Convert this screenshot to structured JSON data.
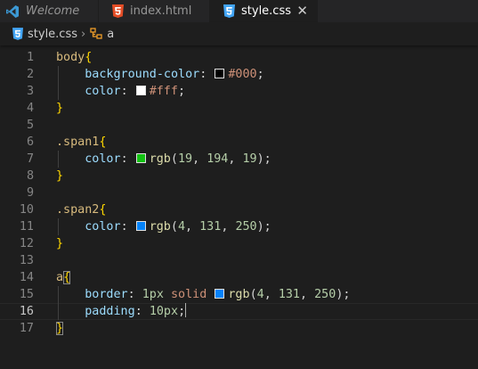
{
  "tabs": [
    {
      "label": "Welcome",
      "icon": "vscode-icon",
      "active": false,
      "italic": true
    },
    {
      "label": "index.html",
      "icon": "html5-icon",
      "active": false
    },
    {
      "label": "style.css",
      "icon": "css3-icon",
      "active": true,
      "close": "✕"
    }
  ],
  "breadcrumb": {
    "file": "style.css",
    "separator": "›",
    "symbol": "a"
  },
  "colors": {
    "tab_bar": "#252526",
    "editor_bg": "#1e1e1e",
    "html_icon": "#e44d26",
    "css_icon": "#42a5f5",
    "vscode_icon": "#3c99d4"
  },
  "editor": {
    "current_line": 16,
    "lines": [
      {
        "n": "1",
        "tokens": [
          [
            "sel",
            "body"
          ],
          [
            "brace",
            "{"
          ]
        ]
      },
      {
        "n": "2",
        "tokens": [
          [
            "ws",
            "    "
          ],
          [
            "prop",
            "background-color"
          ],
          [
            "punc",
            ": "
          ],
          [
            "swatch",
            "#000000"
          ],
          [
            "val",
            "#000"
          ],
          [
            "punc",
            ";"
          ]
        ]
      },
      {
        "n": "3",
        "tokens": [
          [
            "ws",
            "    "
          ],
          [
            "prop",
            "color"
          ],
          [
            "punc",
            ": "
          ],
          [
            "swatch",
            "#ffffff"
          ],
          [
            "val",
            "#fff"
          ],
          [
            "punc",
            ";"
          ]
        ]
      },
      {
        "n": "4",
        "tokens": [
          [
            "brace",
            "}"
          ]
        ]
      },
      {
        "n": "5",
        "tokens": []
      },
      {
        "n": "6",
        "tokens": [
          [
            "sel",
            ".span1"
          ],
          [
            "brace",
            "{"
          ]
        ]
      },
      {
        "n": "7",
        "tokens": [
          [
            "ws",
            "    "
          ],
          [
            "prop",
            "color"
          ],
          [
            "punc",
            ": "
          ],
          [
            "swatch",
            "#13c213"
          ],
          [
            "fn",
            "rgb"
          ],
          [
            "punc",
            "("
          ],
          [
            "num",
            "19"
          ],
          [
            "punc",
            ", "
          ],
          [
            "num",
            "194"
          ],
          [
            "punc",
            ", "
          ],
          [
            "num",
            "19"
          ],
          [
            "punc",
            ");"
          ]
        ]
      },
      {
        "n": "8",
        "tokens": [
          [
            "brace",
            "}"
          ]
        ]
      },
      {
        "n": "9",
        "tokens": []
      },
      {
        "n": "10",
        "tokens": [
          [
            "sel",
            ".span2"
          ],
          [
            "brace",
            "{"
          ]
        ]
      },
      {
        "n": "11",
        "tokens": [
          [
            "ws",
            "    "
          ],
          [
            "prop",
            "color"
          ],
          [
            "punc",
            ": "
          ],
          [
            "swatch",
            "#0483fa"
          ],
          [
            "fn",
            "rgb"
          ],
          [
            "punc",
            "("
          ],
          [
            "num",
            "4"
          ],
          [
            "punc",
            ", "
          ],
          [
            "num",
            "131"
          ],
          [
            "punc",
            ", "
          ],
          [
            "num",
            "250"
          ],
          [
            "punc",
            ");"
          ]
        ]
      },
      {
        "n": "12",
        "tokens": [
          [
            "brace",
            "}"
          ]
        ]
      },
      {
        "n": "13",
        "tokens": []
      },
      {
        "n": "14",
        "tokens": [
          [
            "sel",
            "a"
          ],
          [
            "bracebox",
            "{"
          ]
        ]
      },
      {
        "n": "15",
        "tokens": [
          [
            "ws",
            "    "
          ],
          [
            "prop",
            "border"
          ],
          [
            "punc",
            ": "
          ],
          [
            "num",
            "1px"
          ],
          [
            "punc",
            " "
          ],
          [
            "kw",
            "solid"
          ],
          [
            "punc",
            " "
          ],
          [
            "swatch",
            "#0483fa"
          ],
          [
            "fn",
            "rgb"
          ],
          [
            "punc",
            "("
          ],
          [
            "num",
            "4"
          ],
          [
            "punc",
            ", "
          ],
          [
            "num",
            "131"
          ],
          [
            "punc",
            ", "
          ],
          [
            "num",
            "250"
          ],
          [
            "punc",
            ");"
          ]
        ]
      },
      {
        "n": "16",
        "tokens": [
          [
            "ws",
            "    "
          ],
          [
            "prop",
            "padding"
          ],
          [
            "punc",
            ": "
          ],
          [
            "num",
            "10px"
          ],
          [
            "punc",
            ";"
          ],
          [
            "cursor",
            ""
          ]
        ]
      },
      {
        "n": "17",
        "tokens": [
          [
            "bracebox",
            "}"
          ]
        ]
      }
    ]
  }
}
